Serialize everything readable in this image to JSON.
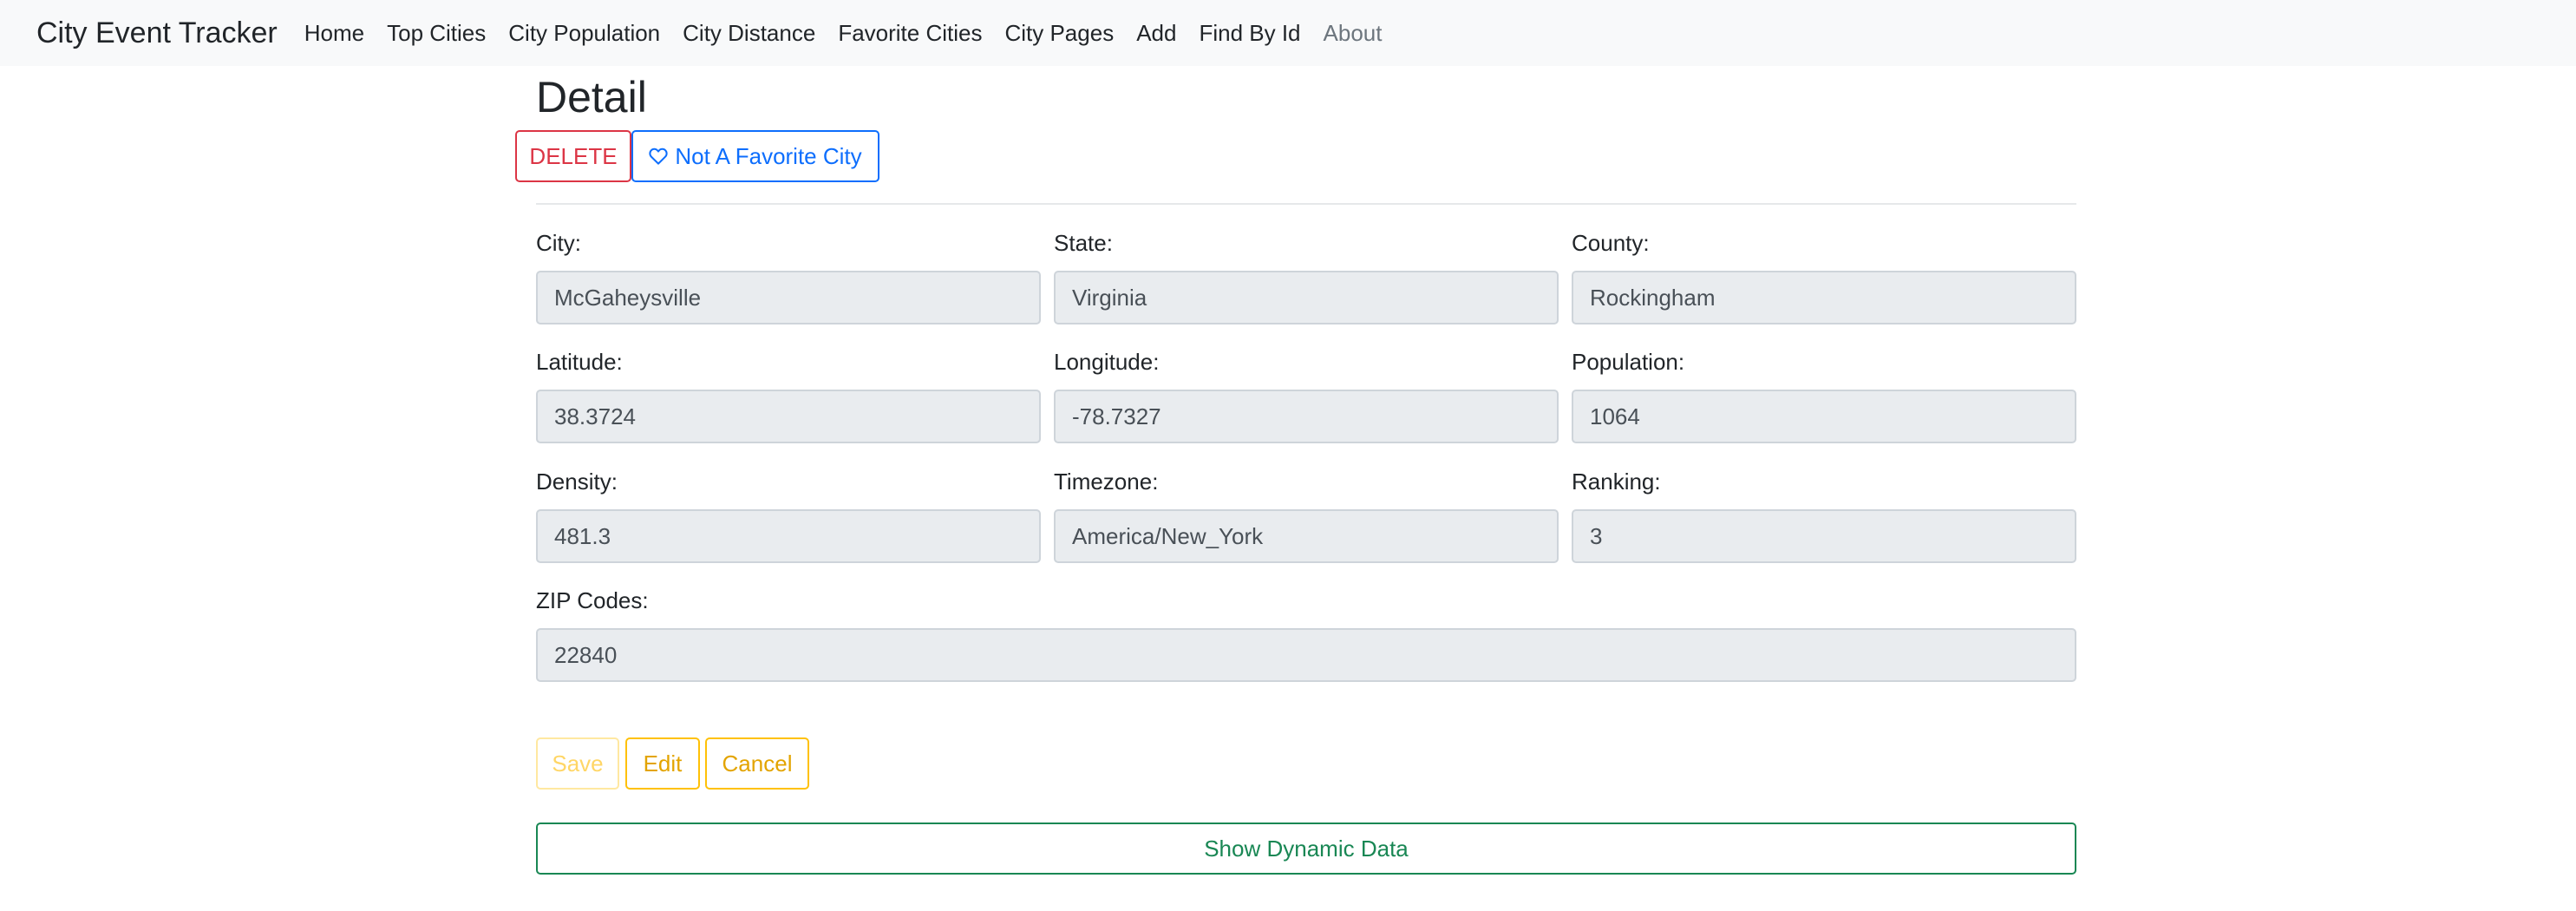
{
  "nav": {
    "brand": "City Event Tracker",
    "links": [
      "Home",
      "Top Cities",
      "City Population",
      "City Distance",
      "Favorite Cities",
      "City Pages",
      "Add",
      "Find By Id",
      "About"
    ]
  },
  "page": {
    "title": "Detail",
    "delete_label": "DELETE",
    "favorite_label": "Not A Favorite City"
  },
  "fields": {
    "city": {
      "label": "City:",
      "value": "McGaheysville"
    },
    "state": {
      "label": "State:",
      "value": "Virginia"
    },
    "county": {
      "label": "County:",
      "value": "Rockingham"
    },
    "latitude": {
      "label": "Latitude:",
      "value": "38.3724"
    },
    "longitude": {
      "label": "Longitude:",
      "value": "-78.7327"
    },
    "population": {
      "label": "Population:",
      "value": "1064"
    },
    "density": {
      "label": "Density:",
      "value": "481.3"
    },
    "timezone": {
      "label": "Timezone:",
      "value": "America/New_York"
    },
    "ranking": {
      "label": "Ranking:",
      "value": "3"
    },
    "zips": {
      "label": "ZIP Codes:",
      "value": "22840"
    }
  },
  "actions": {
    "save_label": "Save",
    "edit_label": "Edit",
    "cancel_label": "Cancel",
    "dynamic_label": "Show Dynamic Data"
  },
  "colors": {
    "danger": "#dc3545",
    "primary": "#0d6efd",
    "warning": "#ffc107",
    "success": "#198754",
    "navbar_bg": "#f8f9fa",
    "input_bg": "#e9ecef"
  },
  "icons": {
    "favorite": "heart-outline-icon"
  }
}
